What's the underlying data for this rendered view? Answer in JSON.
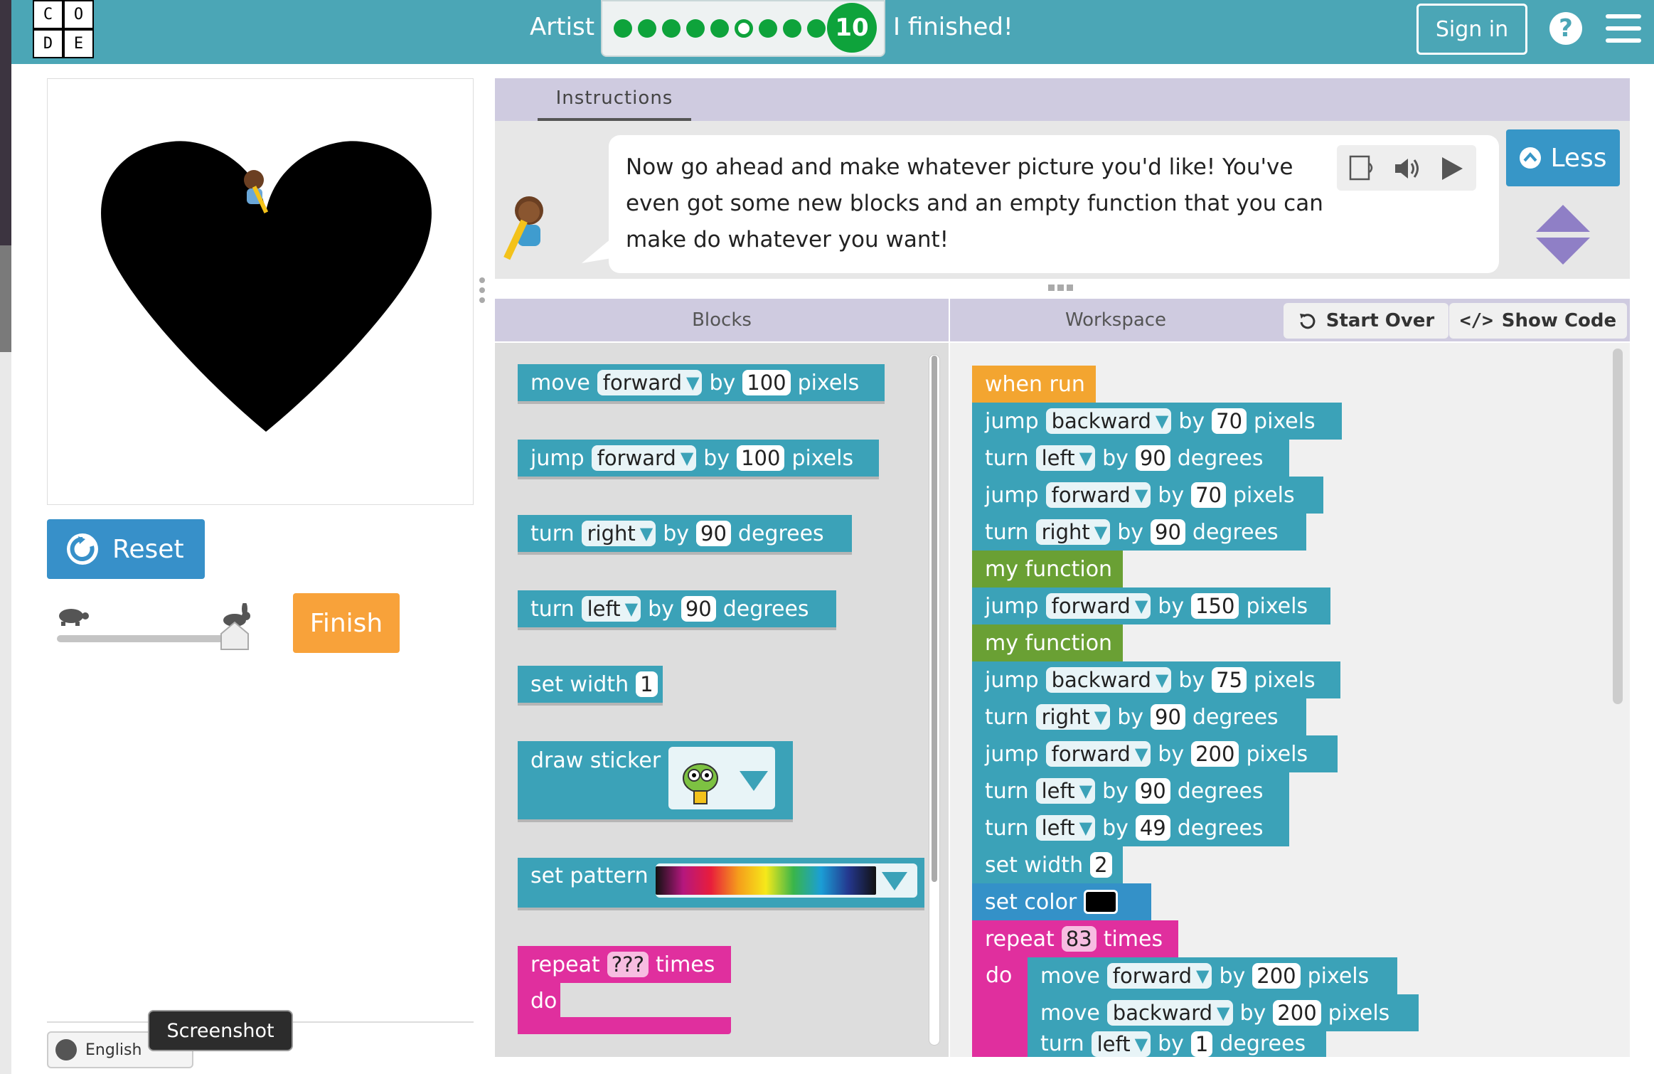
{
  "header": {
    "logo_letters": [
      "C",
      "O",
      "D",
      "E"
    ],
    "level_name": "Artist",
    "progress_dots": 9,
    "current_level": "10",
    "status": "I finished!",
    "sign_in": "Sign in",
    "help_icon": "?"
  },
  "play": {
    "reset_label": "Reset",
    "finish_label": "Finish",
    "speed_fraction": 1.0
  },
  "footer": {
    "language": "English",
    "tooltip": "Screenshot"
  },
  "instructions": {
    "tab_label": "Instructions",
    "text": "Now go ahead and make whatever picture you'd like! You've even got some new blocks and an empty function that you can make do whatever you want!",
    "less_label": "Less"
  },
  "toolbox": {
    "title": "Blocks",
    "b1": {
      "verb": "move",
      "dir": "forward",
      "by": "by",
      "amount": "100",
      "unit": "pixels"
    },
    "b2": {
      "verb": "jump",
      "dir": "forward",
      "by": "by",
      "amount": "100",
      "unit": "pixels"
    },
    "b3": {
      "verb": "turn",
      "dir": "right",
      "by": "by",
      "amount": "90",
      "unit": "degrees"
    },
    "b4": {
      "verb": "turn",
      "dir": "left",
      "by": "by",
      "amount": "90",
      "unit": "degrees"
    },
    "b5": {
      "verb": "set width",
      "amount": "1"
    },
    "b6": {
      "verb": "draw sticker"
    },
    "b7": {
      "verb": "set pattern"
    },
    "b8": {
      "verb": "repeat",
      "amount": "???",
      "unit": "times",
      "do": "do"
    }
  },
  "workspace": {
    "title": "Workspace",
    "start_over": "Start Over",
    "show_code": "Show Code",
    "when_run": "when run",
    "w1": {
      "verb": "jump",
      "dir": "backward",
      "by": "by",
      "amount": "70",
      "unit": "pixels"
    },
    "w2": {
      "verb": "turn",
      "dir": "left",
      "by": "by",
      "amount": "90",
      "unit": "degrees"
    },
    "w3": {
      "verb": "jump",
      "dir": "forward",
      "by": "by",
      "amount": "70",
      "unit": "pixels"
    },
    "w4": {
      "verb": "turn",
      "dir": "right",
      "by": "by",
      "amount": "90",
      "unit": "degrees"
    },
    "w5": {
      "verb": "my function"
    },
    "w6": {
      "verb": "jump",
      "dir": "forward",
      "by": "by",
      "amount": "150",
      "unit": "pixels"
    },
    "w7": {
      "verb": "my function"
    },
    "w8": {
      "verb": "jump",
      "dir": "backward",
      "by": "by",
      "amount": "75",
      "unit": "pixels"
    },
    "w9": {
      "verb": "turn",
      "dir": "right",
      "by": "by",
      "amount": "90",
      "unit": "degrees"
    },
    "w10": {
      "verb": "jump",
      "dir": "forward",
      "by": "by",
      "amount": "200",
      "unit": "pixels"
    },
    "w11": {
      "verb": "turn",
      "dir": "left",
      "by": "by",
      "amount": "90",
      "unit": "degrees"
    },
    "w12": {
      "verb": "turn",
      "dir": "left",
      "by": "by",
      "amount": "49",
      "unit": "degrees"
    },
    "w13": {
      "verb": "set width",
      "amount": "2"
    },
    "w14": {
      "verb": "set color",
      "color": "#000000"
    },
    "w15": {
      "verb": "repeat",
      "amount": "83",
      "unit": "times",
      "do": "do"
    },
    "w16": {
      "verb": "move",
      "dir": "forward",
      "by": "by",
      "amount": "200",
      "unit": "pixels"
    },
    "w17": {
      "verb": "move",
      "dir": "backward",
      "by": "by",
      "amount": "200",
      "unit": "pixels"
    },
    "w18": {
      "verb": "turn",
      "dir": "left",
      "by": "by",
      "amount": "1",
      "unit": "degrees"
    }
  },
  "colors": {
    "header": "#4ba6b6",
    "teal_block": "#3ba2b8",
    "function_block": "#6aa034",
    "event_block": "#f3a530",
    "repeat_block": "#e02f9e",
    "color_block": "#3491c8",
    "reset": "#3790c9",
    "finish": "#f8a23a",
    "progress_green": "#0ea33b"
  }
}
